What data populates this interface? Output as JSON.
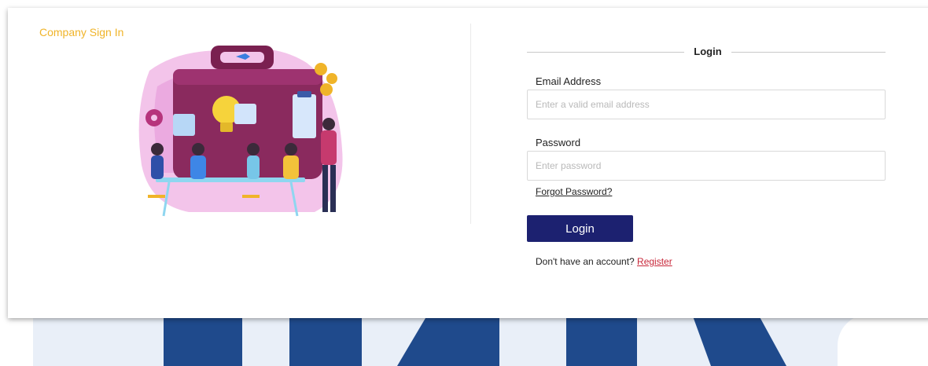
{
  "brand": {
    "title": "Company Sign In"
  },
  "form": {
    "heading": "Login",
    "email": {
      "label": "Email Address",
      "placeholder": "Enter a valid email address",
      "value": ""
    },
    "password": {
      "label": "Password",
      "placeholder": "Enter password",
      "value": ""
    },
    "forgot_link": "Forgot Password?",
    "submit_label": "Login",
    "register_prompt": "Don't have an account?",
    "register_link": "Register"
  },
  "colors": {
    "brand": "#f0b429",
    "primary_button": "#1c2170",
    "register_link": "#c8283a"
  },
  "illustration": {
    "icon": "team-briefcase-illustration"
  }
}
